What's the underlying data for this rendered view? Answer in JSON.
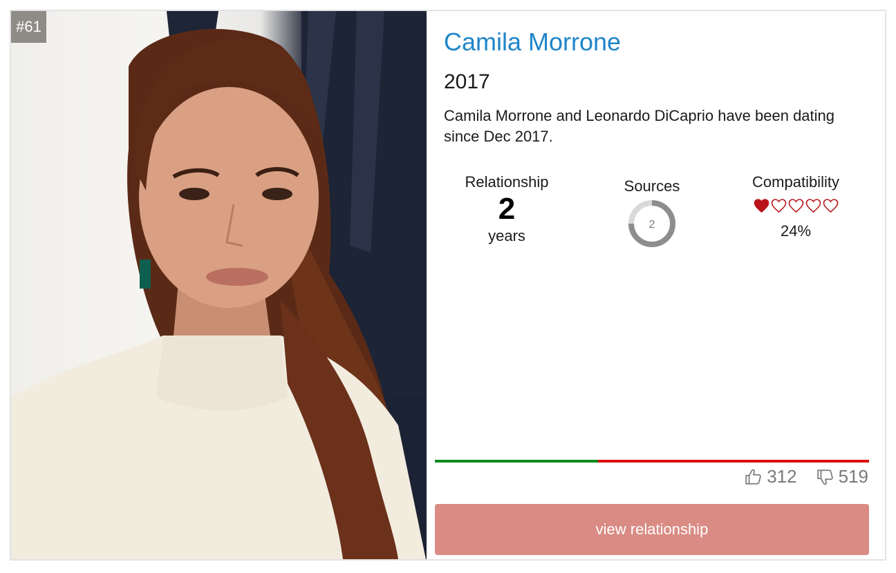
{
  "rank": "#61",
  "name": "Camila Morrone",
  "year": "2017",
  "description": "Camila Morrone and Leonardo DiCaprio have been dating since Dec 2017.",
  "stats": {
    "relationship": {
      "label": "Relationship",
      "value": "2",
      "unit": "years"
    },
    "sources": {
      "label": "Sources",
      "value": "2"
    },
    "compatibility": {
      "label": "Compatibility",
      "hearts_total": 5,
      "hearts_filled": 1,
      "percent": "24%"
    }
  },
  "votes": {
    "up": "312",
    "down": "519",
    "up_fraction": 0.375
  },
  "button": {
    "label": "view relationship"
  },
  "colors": {
    "name": "#1f85c9",
    "heart": "#b8141a",
    "vote_up": "#0a8a1d",
    "vote_down": "#e00d0d",
    "button_bg": "#d98b84"
  },
  "icons": {
    "thumbs_up": "thumbs-up-icon",
    "thumbs_down": "thumbs-down-icon",
    "heart_filled": "heart-filled-icon",
    "heart_outline": "heart-outline-icon"
  }
}
